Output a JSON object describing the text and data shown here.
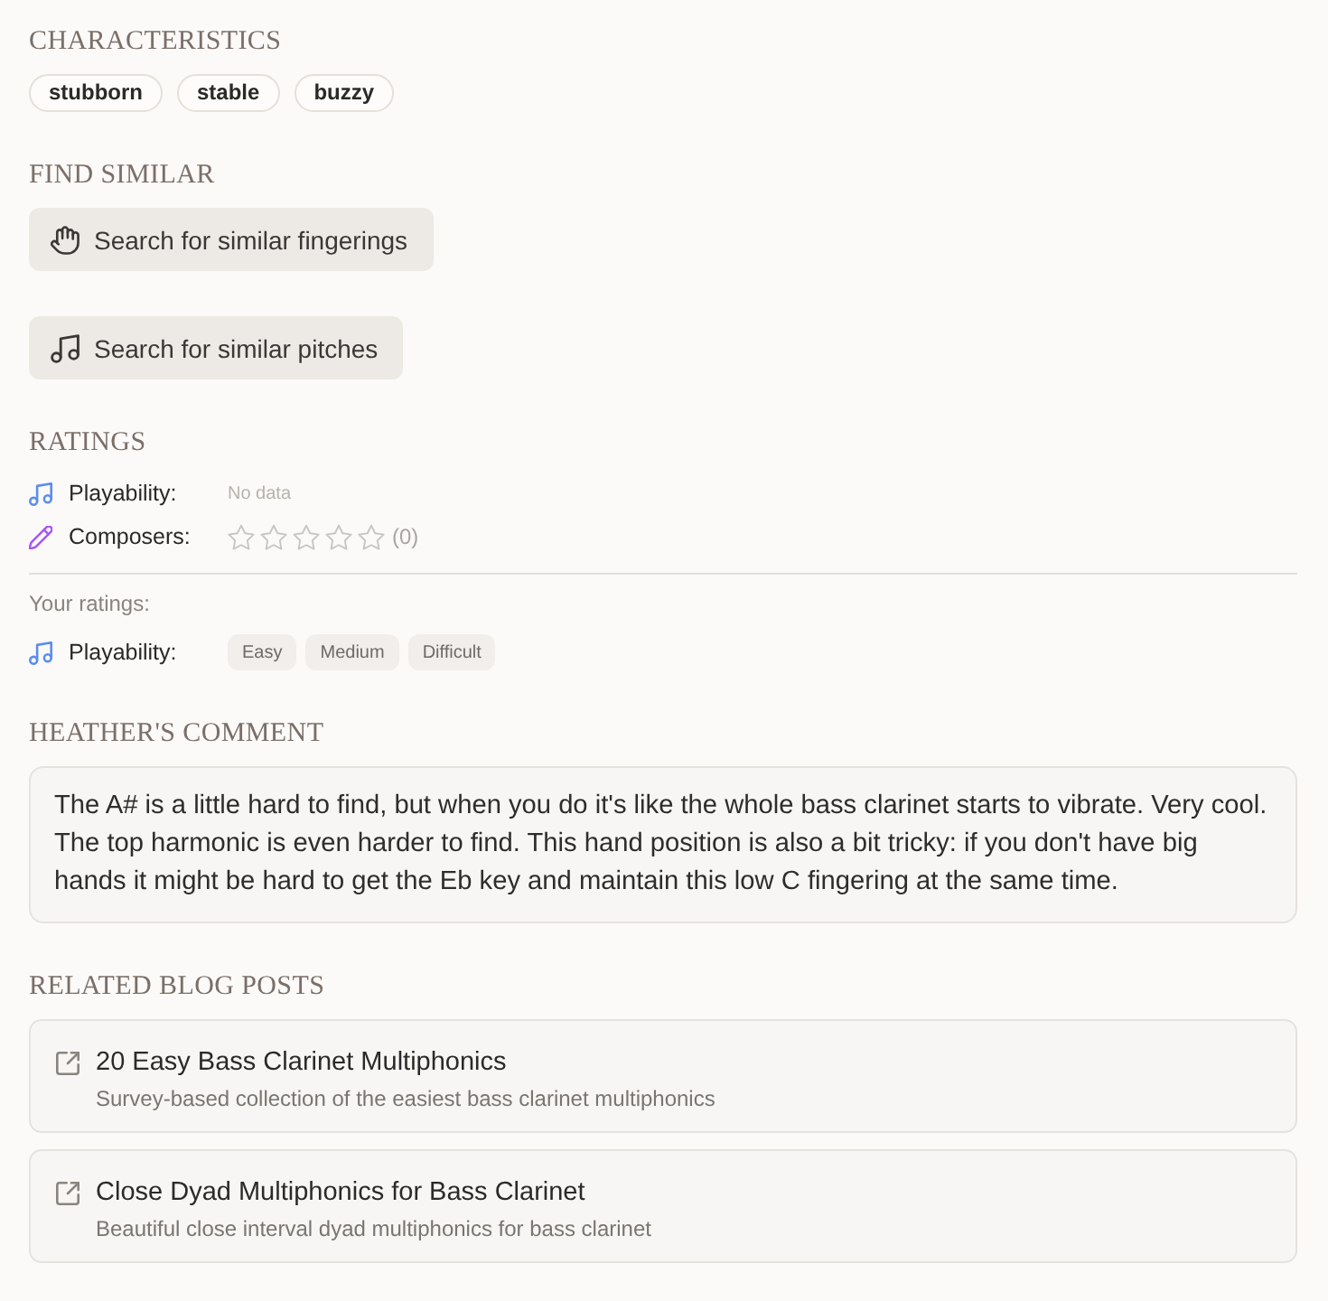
{
  "characteristics": {
    "title": "CHARACTERISTICS",
    "tags": [
      "stubborn",
      "stable",
      "buzzy"
    ]
  },
  "find_similar": {
    "title": "FIND SIMILAR",
    "buttons": [
      {
        "label": "Search for similar fingerings"
      },
      {
        "label": "Search for similar pitches"
      }
    ]
  },
  "ratings": {
    "title": "RATINGS",
    "items": [
      {
        "kind": "text",
        "label": "Playability:",
        "color": "#5b8def",
        "value": "No data"
      },
      {
        "kind": "stars",
        "label": "Composers:",
        "color": "#a855f7",
        "stars": 0,
        "count": "(0)"
      }
    ],
    "your_ratings": {
      "title": "Your ratings:",
      "label": "Playability:",
      "color": "#5b8def",
      "options": [
        {
          "label": "Easy",
          "selected": false
        },
        {
          "label": "Medium",
          "selected": false
        },
        {
          "label": "Difficult",
          "selected": false
        }
      ]
    }
  },
  "comment": {
    "title": "HEATHER'S COMMENT",
    "text": "The A# is a little hard to find, but when you do it's like the whole bass clarinet starts to vibrate. Very cool. The top harmonic is even harder to find. This hand position is also a bit tricky: if you don't have big hands it might be hard to get the Eb key and maintain this low C fingering at the same time."
  },
  "related_posts": {
    "title": "RELATED BLOG POSTS",
    "posts": [
      {
        "title": "20 Easy Bass Clarinet Multiphonics",
        "subtitle": "Survey-based collection of the easiest bass clarinet multiphonics"
      },
      {
        "title": "Close Dyad Multiphonics for Bass Clarinet",
        "subtitle": "Beautiful close interval dyad multiphonics for bass clarinet"
      }
    ]
  }
}
